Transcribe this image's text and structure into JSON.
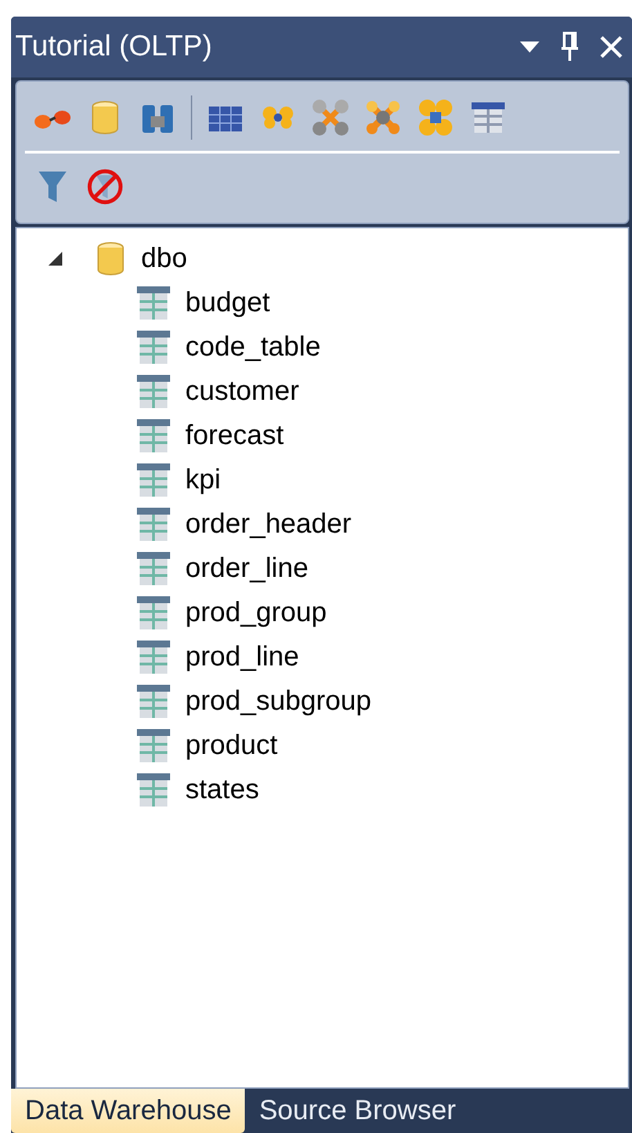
{
  "window": {
    "title": "Tutorial (OLTP)"
  },
  "tree": {
    "label": "dbo",
    "expanded": true,
    "children": [
      {
        "label": "budget"
      },
      {
        "label": "code_table"
      },
      {
        "label": "customer"
      },
      {
        "label": "forecast"
      },
      {
        "label": "kpi"
      },
      {
        "label": "order_header"
      },
      {
        "label": "order_line"
      },
      {
        "label": "prod_group"
      },
      {
        "label": "prod_line"
      },
      {
        "label": "prod_subgroup"
      },
      {
        "label": "product"
      },
      {
        "label": "states"
      }
    ]
  },
  "tabs": [
    {
      "label": "Data Warehouse",
      "selected": true
    },
    {
      "label": "Source Browser",
      "selected": false
    }
  ]
}
